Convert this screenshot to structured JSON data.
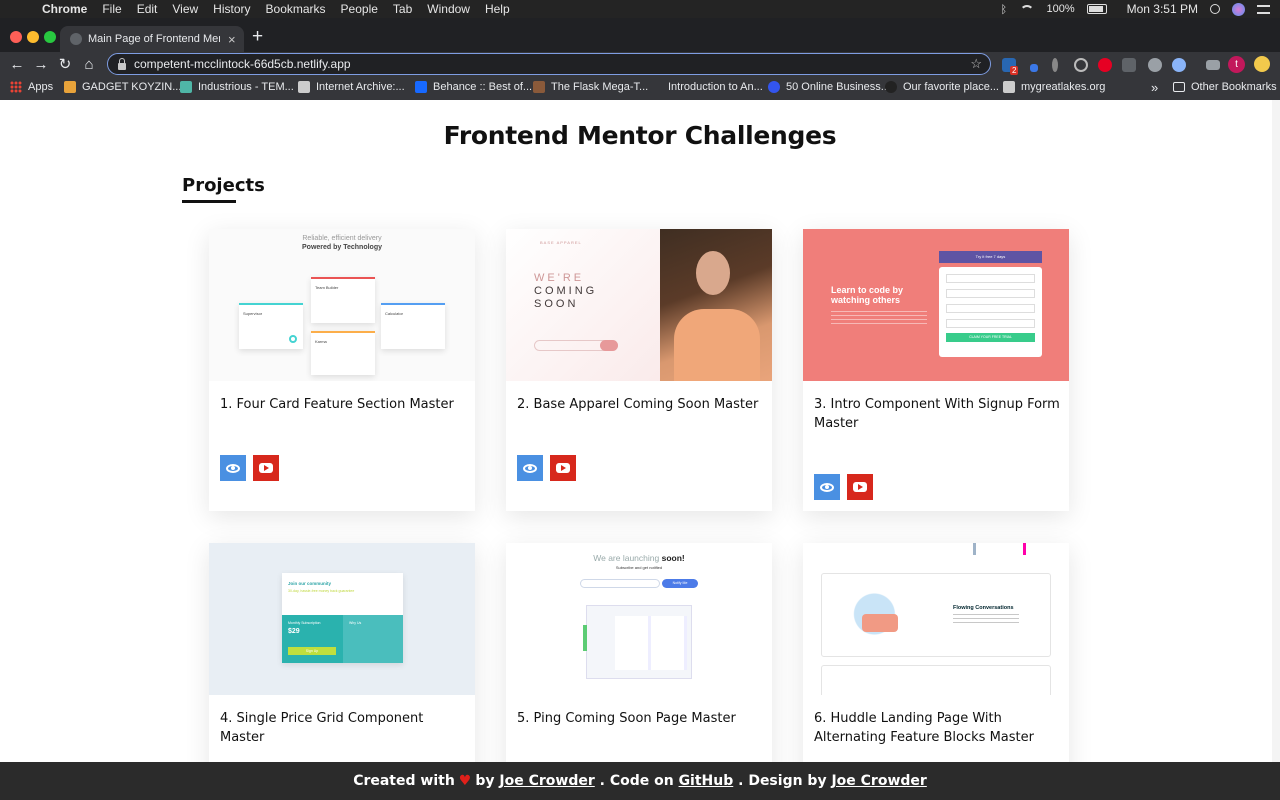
{
  "menubar": {
    "app": "Chrome",
    "items": [
      "File",
      "Edit",
      "View",
      "History",
      "Bookmarks",
      "People",
      "Tab",
      "Window",
      "Help"
    ],
    "battery": "100%",
    "clock": "Mon 3:51 PM"
  },
  "browser": {
    "tab_title": "Main Page of Frontend Mentor",
    "tab_close": "×",
    "new_tab": "+",
    "url": "competent-mcclintock-66d5cb.netlify.app",
    "back": "←",
    "forward": "→",
    "reload": "↻",
    "home": "⌂",
    "star": "☆",
    "bookmarks": [
      {
        "label": "Apps",
        "color": "#ea4335"
      },
      {
        "label": "GADGET KOYZIN...",
        "color": "#e8a33a"
      },
      {
        "label": "Industrious - TEM...",
        "color": "#4fb6a7"
      },
      {
        "label": "Internet Archive:...",
        "color": "#cccccc"
      },
      {
        "label": "Behance :: Best of...",
        "color": "#1769ff"
      },
      {
        "label": "The Flask Mega-T...",
        "color": "#8a5a3a"
      },
      {
        "label": "Introduction to An...",
        "color": "#35363a"
      },
      {
        "label": "50 Online Business...",
        "color": "#3355ee"
      },
      {
        "label": "Our favorite place...",
        "color": "#222222"
      },
      {
        "label": "mygreatlakes.org",
        "color": "#cccccc"
      }
    ],
    "more": "»",
    "other_bookmarks": "Other Bookmarks",
    "ext_badge": "2",
    "profile_initial": "t"
  },
  "page": {
    "title": "Frontend Mentor Challenges",
    "section": "Projects",
    "projects": [
      {
        "title": "1. Four Card Feature Section Master"
      },
      {
        "title": "2. Base Apparel Coming Soon Master"
      },
      {
        "title": "3. Intro Component With Signup Form Master"
      },
      {
        "title": "4. Single Price Grid Component Master"
      },
      {
        "title": "5. Ping Coming Soon Page Master"
      },
      {
        "title": "6. Huddle Landing Page With Alternating Feature Blocks Master"
      }
    ],
    "thumbs": {
      "t1_line1": "Reliable, efficient delivery",
      "t1_line2": "Powered by Technology",
      "t1_cards": [
        "Supervisor",
        "Team Builder",
        "Karma",
        "Calculator"
      ],
      "t2_word1": "WE'RE",
      "t2_word2": "COMING",
      "t2_word3": "SOON",
      "t2_brand": "BASE APPAREL",
      "t3_heading": "Learn to code by watching others",
      "t3_banner": "Try it free 7 days",
      "t3_cta": "CLAIM YOUR FREE TRIAL",
      "t4_heading": "Join our community",
      "t4_sub": "30-day, hassle-free money back guarantee",
      "t4_price": "$29",
      "t4_plan": "Monthly Subscription",
      "t4_why": "Why Us",
      "t4_cta": "Sign Up",
      "t5_heading": "We are launching",
      "t5_soon": "soon!",
      "t5_sub": "Subscribe and get notified",
      "t5_cta": "Notify Me",
      "t6_feature": "Flowing Conversations"
    }
  },
  "footer": {
    "created": "Created with",
    "heart": "♥",
    "by": "by",
    "author": "Joe Crowder",
    "code_on": ". Code on",
    "github": "GitHub",
    "design_by": ". Design by",
    "designer": "Joe Crowder"
  },
  "colors": {
    "live_button": "#4a90e2",
    "youtube_button": "#d7281c",
    "footer_bg": "#2b2b2b",
    "card3_bg": "#f07e7a"
  }
}
